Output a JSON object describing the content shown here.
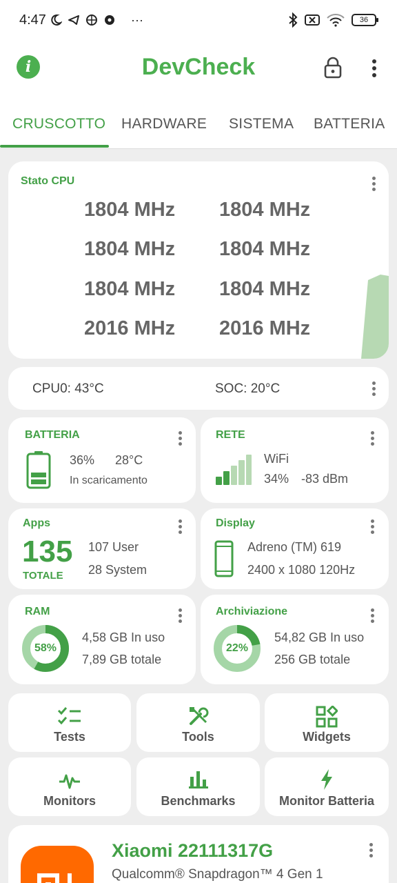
{
  "status_bar": {
    "time": "4:47",
    "left_icons": [
      "moon-icon",
      "telegram-icon",
      "basketball-icon",
      "football-icon",
      "more-horizontal-icon"
    ],
    "right_icons": [
      "bluetooth-icon",
      "no-sim-icon",
      "wifi-icon"
    ],
    "battery_level": "36"
  },
  "app_bar": {
    "title": "DevCheck",
    "accent_color": "#4caf50"
  },
  "tabs": [
    {
      "label": "CRUSCOTTO",
      "active": true
    },
    {
      "label": "HARDWARE",
      "active": false
    },
    {
      "label": "SISTEMA",
      "active": false
    },
    {
      "label": "BATTERIA",
      "active": false
    }
  ],
  "cpu_card": {
    "title": "Stato CPU",
    "frequencies": [
      "1804 MHz",
      "1804 MHz",
      "1804 MHz",
      "1804 MHz",
      "1804 MHz",
      "1804 MHz",
      "2016 MHz",
      "2016 MHz"
    ]
  },
  "temps_card": {
    "cpu": "CPU0: 43°C",
    "soc": "SOC: 20°C"
  },
  "battery_card": {
    "title": "BATTERIA",
    "level": "36%",
    "temp": "28°C",
    "status": "In scaricamento"
  },
  "network_card": {
    "title": "RETE",
    "type": "WiFi",
    "signal": "34%",
    "dbm": "-83 dBm"
  },
  "apps_card": {
    "title": "Apps",
    "total": "135",
    "total_label": "TOTALE",
    "user": "107 User",
    "system": "28 System"
  },
  "display_card": {
    "title": "Display",
    "gpu": "Adreno (TM) 619",
    "resolution": "2400 x 1080  120Hz"
  },
  "ram_card": {
    "title": "RAM",
    "percent": "58%",
    "percent_value": 58,
    "used": "4,58 GB In uso",
    "total": "7,89 GB totale"
  },
  "storage_card": {
    "title": "Archiviazione",
    "percent": "22%",
    "percent_value": 22,
    "used": "54,82 GB In uso",
    "total": "256 GB totale"
  },
  "tools": [
    {
      "label": "Tests",
      "icon": "checklist-icon"
    },
    {
      "label": "Tools",
      "icon": "tools-icon"
    },
    {
      "label": "Widgets",
      "icon": "widgets-icon"
    },
    {
      "label": "Monitors",
      "icon": "pulse-icon"
    },
    {
      "label": "Benchmarks",
      "icon": "bar-chart-icon"
    },
    {
      "label": "Monitor Batteria",
      "icon": "bolt-icon"
    }
  ],
  "device_card": {
    "name": "Xiaomi 22111317G",
    "chip": "Qualcomm® Snapdragon™ 4 Gen 1",
    "logo_text": "MI"
  }
}
